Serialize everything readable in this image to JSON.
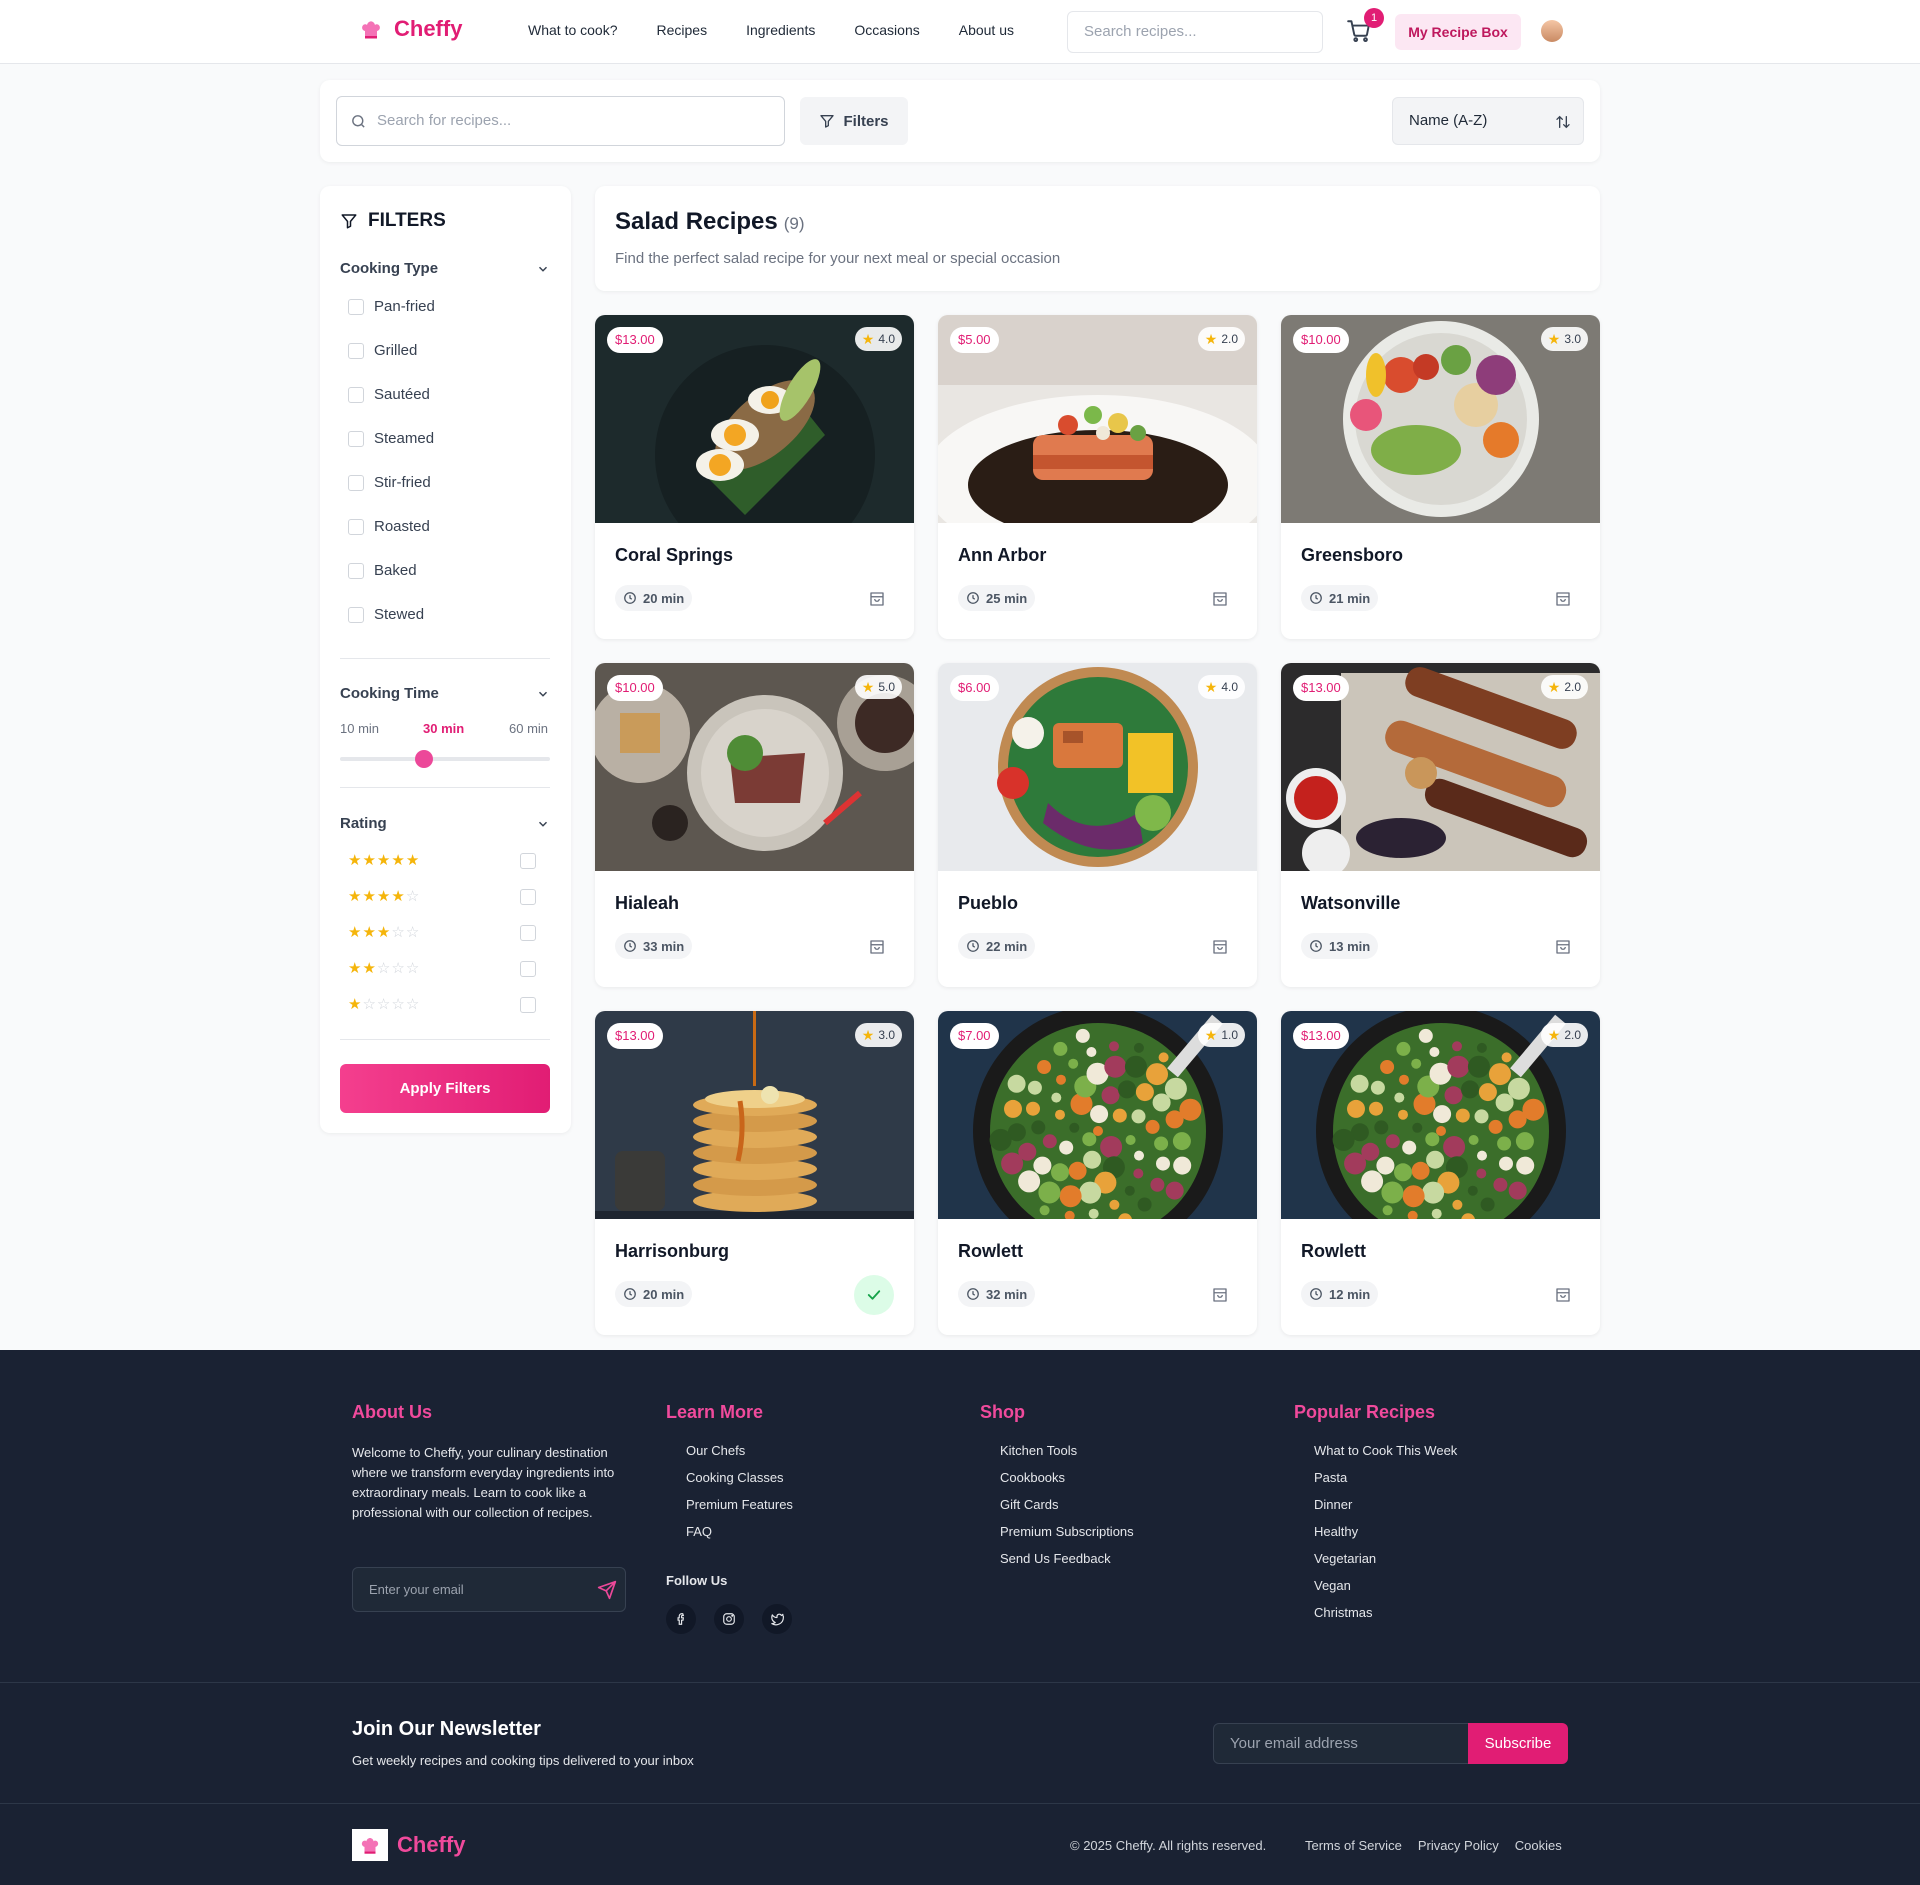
{
  "header": {
    "brand": "Cheffy",
    "nav": [
      "What to cook?",
      "Recipes",
      "Ingredients",
      "Occasions",
      "About us"
    ],
    "search_placeholder": "Search recipes...",
    "cart_count": "1",
    "recipe_box": "My Recipe Box"
  },
  "toolbar": {
    "search_placeholder": "Search for recipes...",
    "filters_label": "Filters",
    "sort_value": "Name (A-Z)"
  },
  "sidebar": {
    "title": "FILTERS",
    "cooking_type": {
      "label": "Cooking Type",
      "options": [
        "Pan-fried",
        "Grilled",
        "Sautéed",
        "Steamed",
        "Stir-fried",
        "Roasted",
        "Baked",
        "Stewed"
      ]
    },
    "cooking_time": {
      "label": "Cooking Time",
      "min": "10 min",
      "current": "30 min",
      "max": "60 min",
      "value_fraction": 0.4
    },
    "rating": {
      "label": "Rating",
      "levels": [
        5,
        4,
        3,
        2,
        1
      ]
    },
    "apply_label": "Apply Filters"
  },
  "main": {
    "title": "Salad Recipes",
    "count": "(9)",
    "subtitle": "Find the perfect salad recipe for your next meal or special occasion",
    "recipes": [
      {
        "name": "Coral Springs",
        "price": "$13.00",
        "rating": "4.0",
        "time": "20 min",
        "added": false,
        "image": "egg-avocado-toast"
      },
      {
        "name": "Ann Arbor",
        "price": "$5.00",
        "rating": "2.0",
        "time": "25 min",
        "added": false,
        "image": "salmon-plate"
      },
      {
        "name": "Greensboro",
        "price": "$10.00",
        "rating": "3.0",
        "time": "21 min",
        "added": false,
        "image": "buddha-bowl"
      },
      {
        "name": "Hialeah",
        "price": "$10.00",
        "rating": "5.0",
        "time": "33 min",
        "added": false,
        "image": "steak-salad-plates"
      },
      {
        "name": "Pueblo",
        "price": "$6.00",
        "rating": "4.0",
        "time": "22 min",
        "added": false,
        "image": "salmon-poke-bowl"
      },
      {
        "name": "Watsonville",
        "price": "$13.00",
        "rating": "2.0",
        "time": "13 min",
        "added": false,
        "image": "grilled-kebabs"
      },
      {
        "name": "Harrisonburg",
        "price": "$13.00",
        "rating": "3.0",
        "time": "20 min",
        "added": true,
        "image": "pancake-stack"
      },
      {
        "name": "Rowlett",
        "price": "$7.00",
        "rating": "1.0",
        "time": "32 min",
        "added": false,
        "image": "green-salad"
      },
      {
        "name": "Rowlett",
        "price": "$13.00",
        "rating": "2.0",
        "time": "12 min",
        "added": false,
        "image": "green-salad"
      }
    ]
  },
  "footer": {
    "about": {
      "title": "About Us",
      "text": "Welcome to Cheffy, your culinary destination where we transform everyday ingredients into extraordinary meals. Learn to cook like a professional with our collection of recipes.",
      "email_placeholder": "Enter your email"
    },
    "learn": {
      "title": "Learn More",
      "links": [
        "Our Chefs",
        "Cooking Classes",
        "Premium Features",
        "FAQ"
      ],
      "follow": "Follow Us"
    },
    "shop": {
      "title": "Shop",
      "links": [
        "Kitchen Tools",
        "Cookbooks",
        "Gift Cards",
        "Premium Subscriptions",
        "Send Us Feedback"
      ]
    },
    "popular": {
      "title": "Popular Recipes",
      "links": [
        "What to Cook This Week",
        "Pasta",
        "Dinner",
        "Healthy",
        "Vegetarian",
        "Vegan",
        "Christmas"
      ]
    },
    "newsletter": {
      "title": "Join Our Newsletter",
      "subtitle": "Get weekly recipes and cooking tips delivered to your inbox",
      "placeholder": "Your email address",
      "button": "Subscribe"
    },
    "brand": "Cheffy",
    "copyright": "© 2025 Cheffy. All rights reserved.",
    "legal": [
      "Terms of Service",
      "Privacy Policy",
      "Cookies"
    ]
  },
  "colors": {
    "accent": "#e11d74",
    "footer_bg": "#1a2233",
    "star": "#f5b50b"
  }
}
